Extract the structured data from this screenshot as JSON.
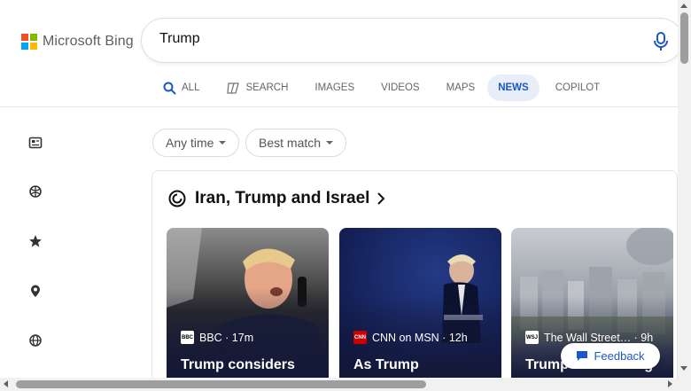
{
  "brand": {
    "name": "Microsoft Bing",
    "logo_colors": [
      "#f25022",
      "#7fba00",
      "#00a4ef",
      "#ffb900"
    ]
  },
  "search": {
    "value": "Trump",
    "mic_icon": "microphone-icon"
  },
  "tabs": [
    {
      "label": "ALL",
      "icon": "search-icon"
    },
    {
      "label": "SEARCH",
      "icon": "copilot-search-icon"
    },
    {
      "label": "IMAGES"
    },
    {
      "label": "VIDEOS"
    },
    {
      "label": "MAPS"
    },
    {
      "label": "NEWS",
      "active": true
    },
    {
      "label": "COPILOT"
    }
  ],
  "rail": [
    "news-icon",
    "sports-icon",
    "star-icon",
    "location-icon",
    "globe-icon"
  ],
  "filters": {
    "time": "Any time",
    "sort": "Best match"
  },
  "topic": {
    "title": "Iran, Trump and Israel"
  },
  "cards": [
    {
      "source": "BBC · 17m",
      "headline": "Trump considers",
      "badge": "BBC"
    },
    {
      "source": "CNN on MSN · 12h",
      "headline": "As Trump",
      "badge": "CNN"
    },
    {
      "source": "The Wall Street… · 9h",
      "headline": "Trump considering",
      "badge": "WSJ"
    }
  ],
  "feedback": "Feedback",
  "colors": {
    "accent": "#1a58c8",
    "active_tab_bg": "#e8eef9",
    "cnn_red": "#cc0000"
  }
}
